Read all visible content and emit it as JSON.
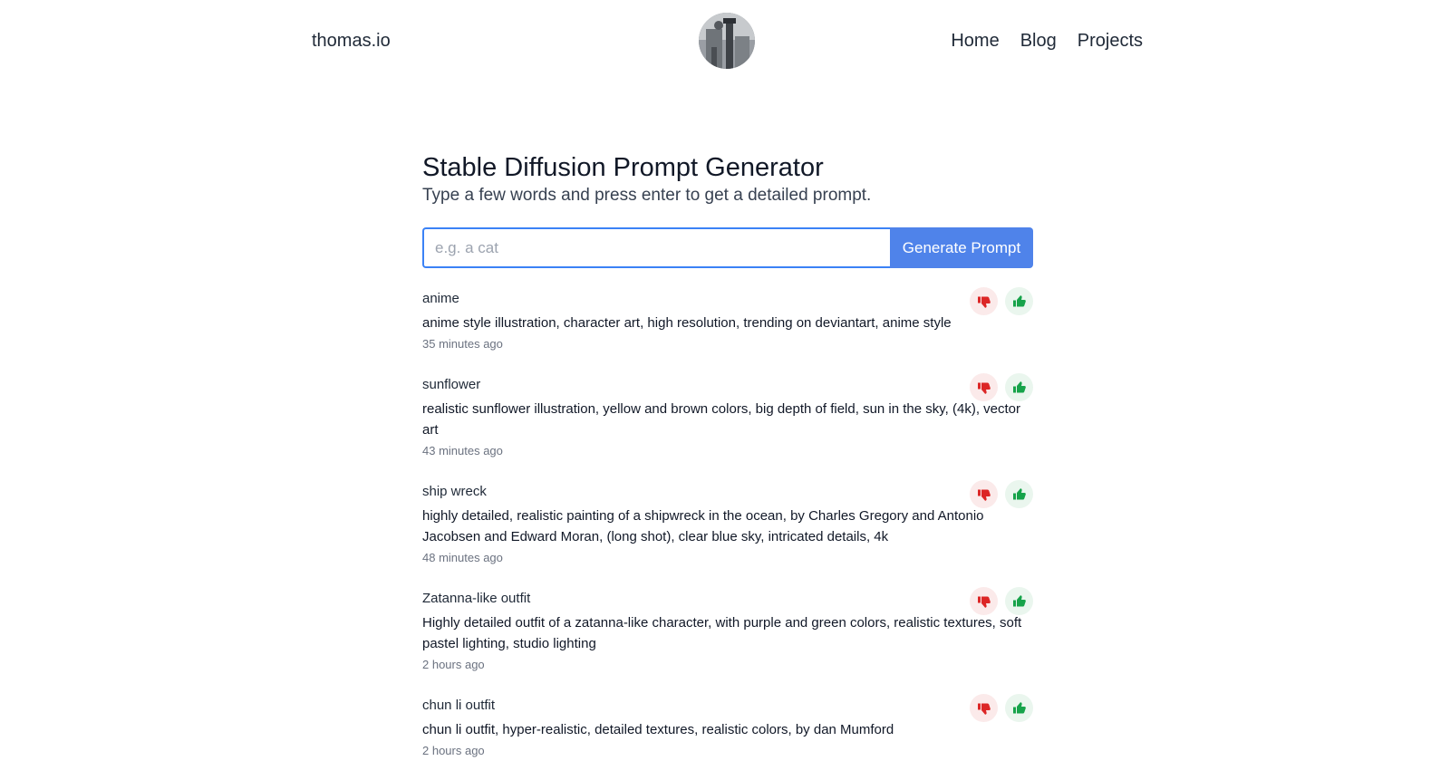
{
  "header": {
    "site_name": "thomas.io",
    "nav": [
      {
        "label": "Home"
      },
      {
        "label": "Blog"
      },
      {
        "label": "Projects"
      }
    ]
  },
  "page": {
    "title": "Stable Diffusion Prompt Generator",
    "subtitle": "Type a few words and press enter to get a detailed prompt."
  },
  "form": {
    "input_value": "",
    "input_placeholder": "e.g. a cat",
    "button_label": "Generate Prompt"
  },
  "colors": {
    "accent": "#4f83ea",
    "thumbs_down": "#dc2626",
    "thumbs_up": "#16a34a"
  },
  "icons": {
    "vote_down": "thumbs-down-icon",
    "vote_up": "thumbs-up-icon"
  },
  "results": [
    {
      "keyword": "anime",
      "prompt": "anime style illustration, character art, high resolution, trending on deviantart, anime style",
      "time": "35 minutes ago"
    },
    {
      "keyword": "sunflower",
      "prompt": "realistic sunflower illustration, yellow and brown colors, big depth of field, sun in the sky, (4k), vector art",
      "time": "43 minutes ago"
    },
    {
      "keyword": "ship wreck",
      "prompt": "highly detailed, realistic painting of a shipwreck in the ocean, by Charles Gregory and Antonio Jacobsen and Edward Moran, (long shot), clear blue sky, intricated details, 4k",
      "time": "48 minutes ago"
    },
    {
      "keyword": "Zatanna-like outfit",
      "prompt": "Highly detailed outfit of a zatanna-like character, with purple and green colors, realistic textures, soft pastel lighting, studio lighting",
      "time": "2 hours ago"
    },
    {
      "keyword": "chun li outfit",
      "prompt": "chun li outfit, hyper-realistic, detailed textures, realistic colors, by dan Mumford",
      "time": "2 hours ago"
    }
  ]
}
